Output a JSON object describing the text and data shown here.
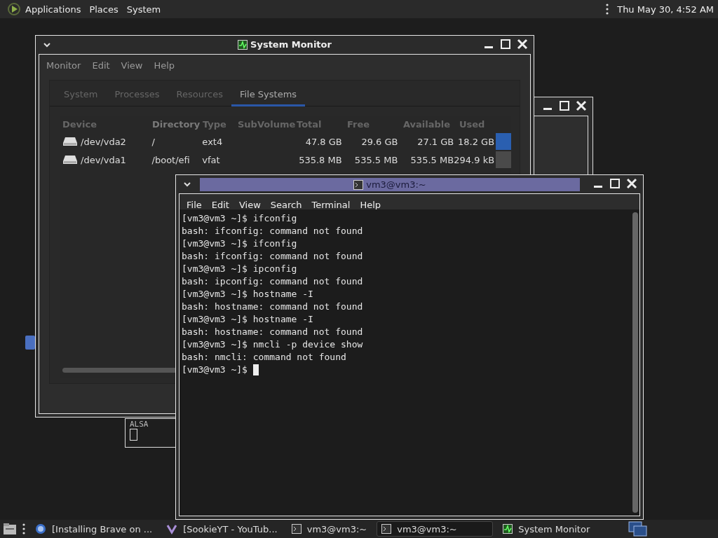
{
  "top_panel": {
    "menus": [
      "Applications",
      "Places",
      "System"
    ],
    "clock": "Thu May 30,  4:52 AM"
  },
  "back_window": {
    "text": "ALSA"
  },
  "system_monitor": {
    "title": "System Monitor",
    "menu": [
      "Monitor",
      "Edit",
      "View",
      "Help"
    ],
    "tabs": [
      {
        "label": "System",
        "selected": false
      },
      {
        "label": "Processes",
        "selected": false
      },
      {
        "label": "Resources",
        "selected": false
      },
      {
        "label": "File Systems",
        "selected": true
      }
    ],
    "columns": [
      {
        "label": "Device",
        "sorted": false
      },
      {
        "label": "Directory",
        "sorted": true
      },
      {
        "label": "Type",
        "sorted": false
      },
      {
        "label": "SubVolume",
        "sorted": false
      },
      {
        "label": "Total",
        "sorted": false
      },
      {
        "label": "Free",
        "sorted": false
      },
      {
        "label": "Available",
        "sorted": false
      },
      {
        "label": "Used",
        "sorted": false
      }
    ],
    "rows": [
      {
        "device": "/dev/vda2",
        "directory": "/",
        "type": "ext4",
        "total": "47.8 GB",
        "free": "29.6 GB",
        "available": "27.1 GB",
        "used": "18.2 GB",
        "color": "#2a5fb0"
      },
      {
        "device": "/dev/vda1",
        "directory": "/boot/efi",
        "type": "vfat",
        "total": "535.8 MB",
        "free": "535.5 MB",
        "available": "535.5 MB",
        "used": "294.9 kB",
        "color": "#4a4a4a"
      }
    ]
  },
  "terminal": {
    "title": "vm3@vm3:~",
    "active": true,
    "menu": [
      "File",
      "Edit",
      "View",
      "Search",
      "Terminal",
      "Help"
    ],
    "lines": [
      "[vm3@vm3 ~]$ ifconfig",
      "bash: ifconfig: command not found",
      "[vm3@vm3 ~]$ ifconfig",
      "bash: ifconfig: command not found",
      "[vm3@vm3 ~]$ ipconfig",
      "bash: ipconfig: command not found",
      "[vm3@vm3 ~]$ hostname -I",
      "bash: hostname: command not found",
      "[vm3@vm3 ~]$ hostname -I",
      "bash: hostname: command not found",
      "[vm3@vm3 ~]$ nmcli -p device show",
      "bash: nmcli: command not found"
    ],
    "prompt": "[vm3@vm3 ~]$ "
  },
  "taskbar": {
    "items": [
      {
        "label": "[Installing Brave on ...",
        "kind": "browser",
        "selected": false
      },
      {
        "label": "[SookieYT - YouTub...",
        "kind": "app",
        "selected": false
      },
      {
        "label": "vm3@vm3:~",
        "kind": "terminal",
        "selected": false
      },
      {
        "label": "vm3@vm3:~",
        "kind": "terminal",
        "selected": true
      },
      {
        "label": "System Monitor",
        "kind": "monitor",
        "selected": false
      }
    ]
  }
}
